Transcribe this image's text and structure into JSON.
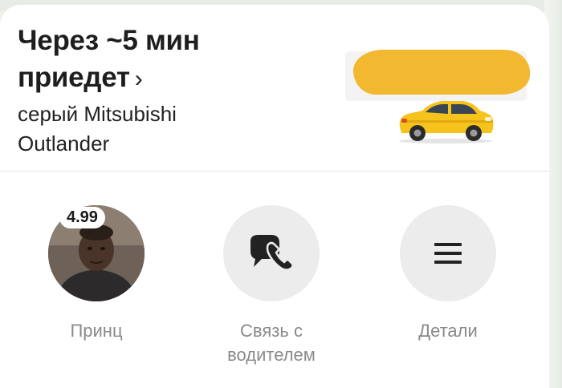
{
  "header": {
    "eta_line1": "Через ~5 мин",
    "eta_line2": "приедет",
    "eta_chevron": "›",
    "car_line1": "серый Mitsubishi",
    "car_line2": "Outlander"
  },
  "driver": {
    "name": "Принц",
    "rating": "4.99"
  },
  "actions": {
    "contact_line1": "Связь с",
    "contact_line2": "водителем",
    "details_label": "Детали"
  },
  "colors": {
    "accent_yellow": "#f2b830",
    "car_yellow": "#f6c21c",
    "circle_gray": "#ececec",
    "label_gray": "#8a8a8a"
  },
  "icons": {
    "car": "taxi-car-icon",
    "phone": "phone-chat-icon",
    "details": "menu-lines-icon"
  }
}
